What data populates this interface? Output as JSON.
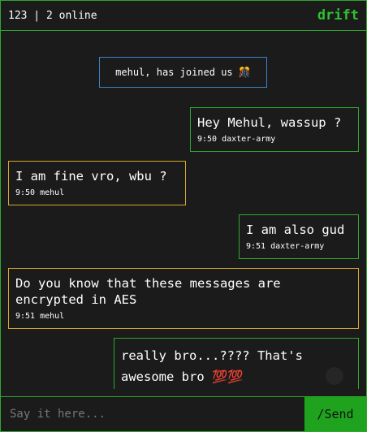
{
  "header": {
    "room_info": "123 | 2 online",
    "brand": "drift"
  },
  "colors": {
    "accent_green": "#2ea82e",
    "other_border": "#d6a92a",
    "system_border": "#3a86c6",
    "send_bg": "#1fa31f"
  },
  "system_message": {
    "text": "mehul, has joined us 🎊"
  },
  "messages": [
    {
      "text": "Hey Mehul, wassup ?",
      "meta": "9:50 daxter-army",
      "own": true
    },
    {
      "text": "I am fine vro, wbu ?",
      "meta": "9:50 mehul",
      "own": false
    },
    {
      "text": "I am also gud",
      "meta": "9:51 daxter-army",
      "own": true
    },
    {
      "text": "Do you know that these messages are encrypted in AES",
      "meta": "9:51 mehul",
      "own": false
    },
    {
      "text": "really bro...???? That's awesome bro 💯💯",
      "meta": "",
      "own": true
    }
  ],
  "composer": {
    "placeholder": "Say it here...",
    "value": "",
    "send_label": "/Send"
  }
}
